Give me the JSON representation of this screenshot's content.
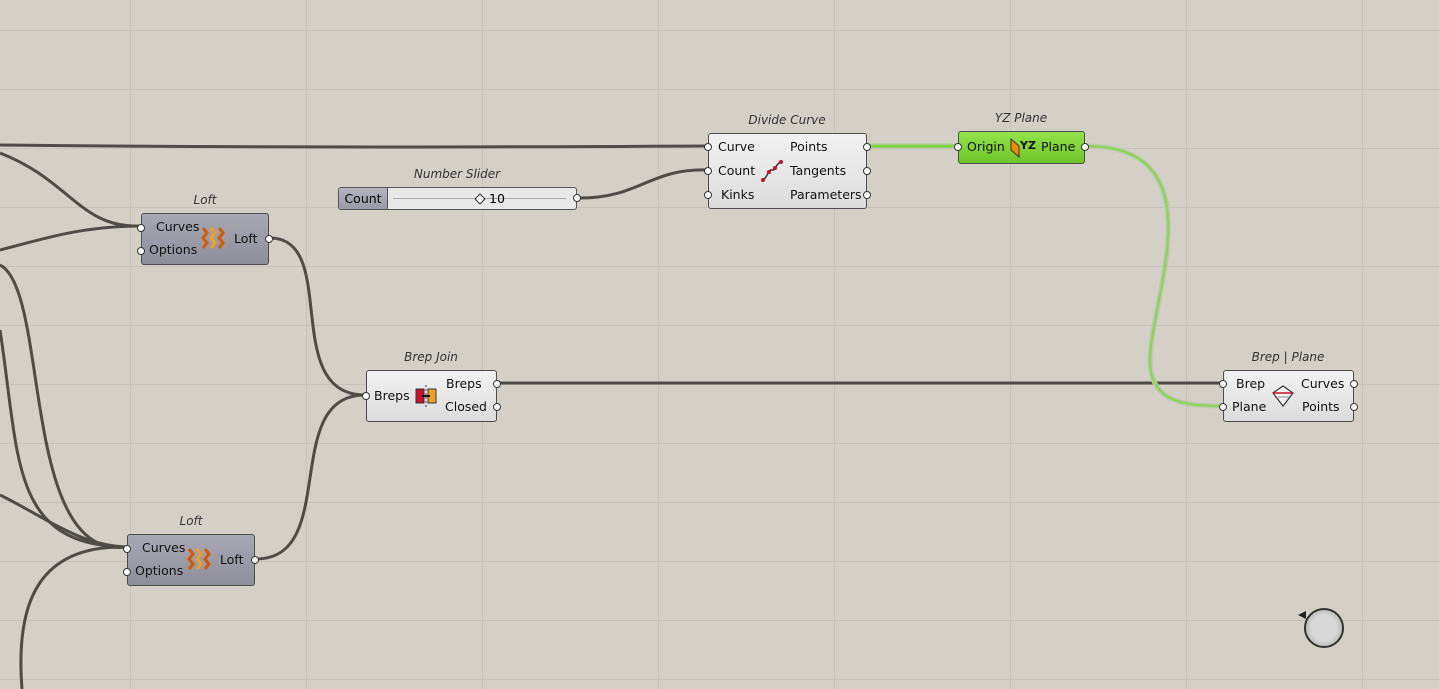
{
  "components": {
    "loft_top": {
      "title": "Loft",
      "inputs": [
        "Curves",
        "Options"
      ],
      "output": "Loft"
    },
    "loft_bottom": {
      "title": "Loft",
      "inputs": [
        "Curves",
        "Options"
      ],
      "output": "Loft"
    },
    "number_slider": {
      "title": "Number Slider",
      "label": "Count",
      "value": "10"
    },
    "divide_curve": {
      "title": "Divide Curve",
      "inputs": [
        "Curve",
        "Count",
        "Kinks"
      ],
      "outputs": [
        "Points",
        "Tangents",
        "Parameters"
      ]
    },
    "yz_plane": {
      "title": "YZ Plane",
      "input": "Origin",
      "output": "Plane",
      "badge": "YZ"
    },
    "brep_join": {
      "title": "Brep Join",
      "input": "Breps",
      "outputs": [
        "Breps",
        "Closed"
      ]
    },
    "brep_plane": {
      "title": "Brep | Plane",
      "inputs": [
        "Brep",
        "Plane"
      ],
      "outputs": [
        "Curves",
        "Points"
      ]
    }
  },
  "colors": {
    "canvas": "#d4d0c8",
    "wire": "#4f4c47",
    "selected_wire": "#7ed63a",
    "component_dark": "#9a9aa7",
    "component_light": "#e8e8e8",
    "component_selected": "#7ed63a"
  },
  "icons": [
    "loft-icon",
    "brep-join-icon",
    "divide-curve-icon",
    "yz-plane-icon",
    "brep-plane-icon",
    "navigation-wheel-icon"
  ]
}
